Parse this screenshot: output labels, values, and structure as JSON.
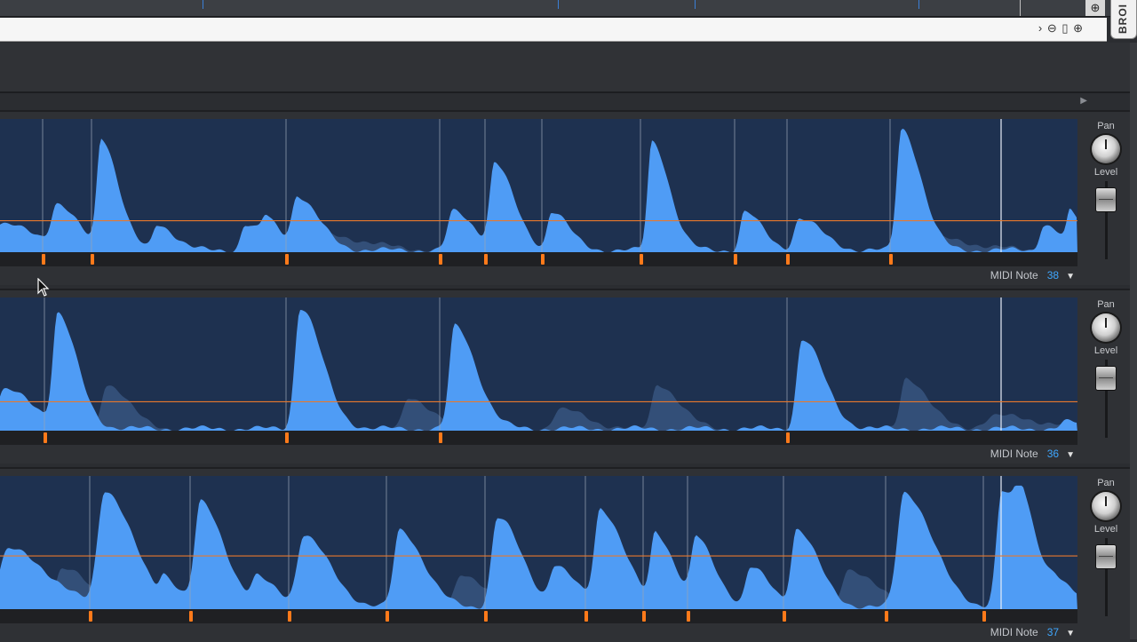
{
  "header": {
    "zoom_icon": "zoom-in-icon",
    "nav_controls": "› ⊖ ▯ ⊕",
    "browse_tab_label": "BROI"
  },
  "lanes": [
    {
      "midi_label": "MIDI Note",
      "midi_value": "38",
      "pan_label": "Pan",
      "level_label": "Level",
      "pan_value": 0.5,
      "level_value": 0.85,
      "threshold": 0.26,
      "markers": [
        47,
        102,
        321,
        494,
        545,
        609,
        720,
        826,
        885,
        1001
      ],
      "peaks": [
        [
          0,
          0.2,
          18
        ],
        [
          64,
          0.3,
          10
        ],
        [
          114,
          0.85,
          8
        ],
        [
          177,
          0.2,
          8
        ],
        [
          276,
          0.2,
          8
        ],
        [
          300,
          0.18,
          8
        ],
        [
          335,
          0.4,
          10
        ],
        [
          510,
          0.3,
          10
        ],
        [
          557,
          0.65,
          9
        ],
        [
          621,
          0.3,
          8
        ],
        [
          734,
          0.85,
          8
        ],
        [
          838,
          0.3,
          8
        ],
        [
          900,
          0.25,
          10
        ],
        [
          1015,
          0.95,
          9
        ],
        [
          1175,
          0.2,
          8
        ],
        [
          1205,
          0.25,
          6
        ]
      ],
      "ghosts": [
        [
          360,
          0.12,
          20
        ],
        [
          1040,
          0.1,
          20
        ]
      ]
    },
    {
      "midi_label": "MIDI Note",
      "midi_value": "36",
      "pan_label": "Pan",
      "level_label": "Level",
      "pan_value": 0.5,
      "level_value": 0.85,
      "threshold": 0.24,
      "markers": [
        49,
        321,
        494,
        885
      ],
      "peaks": [
        [
          5,
          0.3,
          14
        ],
        [
          65,
          0.85,
          9
        ],
        [
          338,
          0.95,
          10
        ],
        [
          512,
          0.8,
          10
        ],
        [
          903,
          0.7,
          10
        ],
        [
          1200,
          0.05,
          10
        ]
      ],
      "ghosts": [
        [
          120,
          0.35,
          10
        ],
        [
          460,
          0.25,
          10
        ],
        [
          740,
          0.35,
          10
        ],
        [
          1020,
          0.4,
          10
        ],
        [
          630,
          0.15,
          12
        ],
        [
          1120,
          0.1,
          20
        ]
      ]
    },
    {
      "midi_label": "MIDI Note",
      "midi_value": "37",
      "pan_label": "Pan",
      "level_label": "Level",
      "pan_value": 0.5,
      "level_value": 0.85,
      "threshold": 0.43,
      "markers": [
        100,
        213,
        324,
        434,
        545,
        658,
        723,
        773,
        881,
        996,
        1106
      ],
      "peaks": [
        [
          118,
          0.9,
          13
        ],
        [
          185,
          0.18,
          8
        ],
        [
          226,
          0.8,
          11
        ],
        [
          290,
          0.2,
          10
        ],
        [
          342,
          0.55,
          12
        ],
        [
          450,
          0.6,
          11
        ],
        [
          560,
          0.7,
          11
        ],
        [
          625,
          0.3,
          10
        ],
        [
          676,
          0.75,
          11
        ],
        [
          738,
          0.55,
          9
        ],
        [
          784,
          0.5,
          9
        ],
        [
          845,
          0.3,
          9
        ],
        [
          897,
          0.6,
          10
        ],
        [
          1018,
          0.9,
          13
        ],
        [
          1128,
          0.9,
          10
        ],
        [
          1150,
          0.4,
          10
        ],
        [
          1190,
          0.12,
          12
        ],
        [
          10,
          0.45,
          18
        ]
      ],
      "ghosts": [
        [
          70,
          0.3,
          12
        ],
        [
          520,
          0.25,
          12
        ],
        [
          955,
          0.3,
          12
        ],
        [
          1240,
          0.1,
          10
        ]
      ]
    }
  ]
}
